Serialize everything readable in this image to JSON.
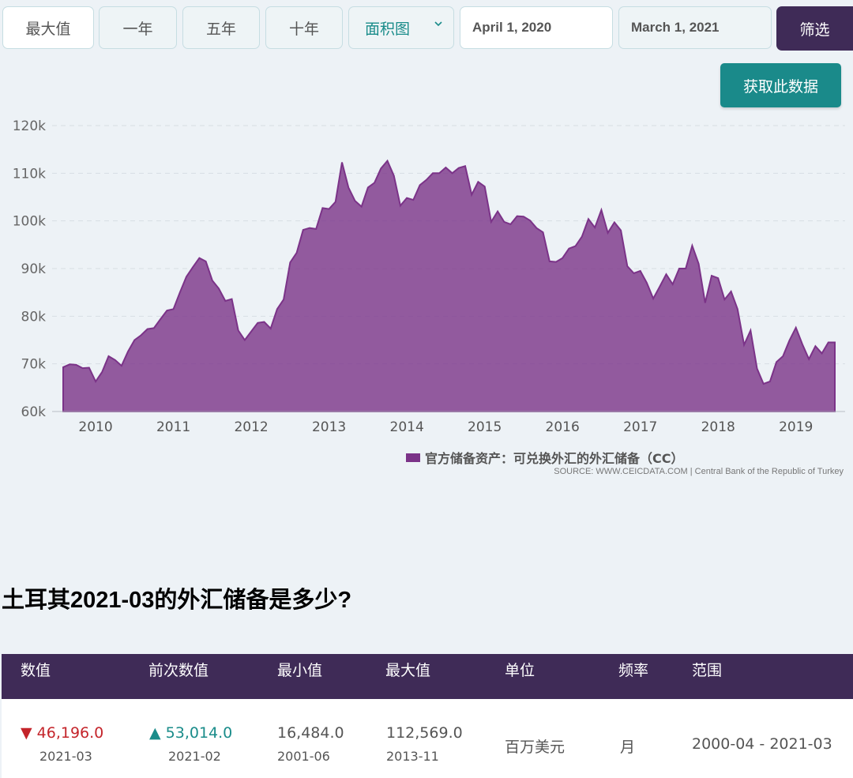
{
  "toolbar": {
    "buttons": [
      "最大值",
      "一年",
      "五年",
      "十年"
    ],
    "chart_type": "面积图",
    "start_date": "April 1, 2020",
    "end_date": "March 1, 2021",
    "filter_label": "筛选",
    "get_data_label": "获取此数据"
  },
  "colors": {
    "area": "#7b3388",
    "accent": "#1a8a8a",
    "header": "#3f2b57"
  },
  "source": "SOURCE: WWW.CEICDATA.COM | Central Bank of the Republic of Turkey",
  "question": "土耳其2021-03的外汇储备是多少?",
  "table": {
    "headers": [
      "数值",
      "前次数值",
      "最小值",
      "最大值",
      "单位",
      "频率",
      "范围"
    ],
    "value": "46,196.0",
    "value_date": "2021-03",
    "prev_value": "53,014.0",
    "prev_date": "2021-02",
    "min_value": "16,484.0",
    "min_date": "2001-06",
    "max_value": "112,569.0",
    "max_date": "2013-11",
    "unit": "百万美元",
    "frequency": "月",
    "range": "2000-04 - 2021-03"
  },
  "chart_data": {
    "type": "area",
    "series": [
      {
        "name": "官方储备资产：可兑换外汇的外汇储备（CC）",
        "x_start": "2009-08",
        "frequency": "monthly",
        "values": [
          69.3,
          69.9,
          69.8,
          69.1,
          69.2,
          66.3,
          68.3,
          71.6,
          70.8,
          69.6,
          72.6,
          75.0,
          76.0,
          77.3,
          77.5,
          79.4,
          81.2,
          81.5,
          85.0,
          88.3,
          90.3,
          92.2,
          91.5,
          87.5,
          85.8,
          83.2,
          83.6,
          77.0,
          75.0,
          76.8,
          78.6,
          78.8,
          77.4,
          81.5,
          83.5,
          91.3,
          93.3,
          98.1,
          98.5,
          98.3,
          102.7,
          102.5,
          104.0,
          112.3,
          107.0,
          104.2,
          103.0,
          107.0,
          108.0,
          111.0,
          112.6,
          109.5,
          103.2,
          104.8,
          104.4,
          107.5,
          108.6,
          110.0,
          110.0,
          111.2,
          110.0,
          111.1,
          111.5,
          105.5,
          108.2,
          107.2,
          99.8,
          102.0,
          99.8,
          99.3,
          101.0,
          100.9,
          100.1,
          98.5,
          97.6,
          91.5,
          91.4,
          92.2,
          94.2,
          94.7,
          96.7,
          100.4,
          98.6,
          102.3,
          97.5,
          99.7,
          98.0,
          90.5,
          89.0,
          89.5,
          87.0,
          83.7,
          86.2,
          88.8,
          86.7,
          90.0,
          90.0,
          94.8,
          91.0,
          82.8,
          88.5,
          88.0,
          83.5,
          85.2,
          81.5,
          74.0,
          77.0,
          69.0,
          65.8,
          66.3,
          70.4,
          71.6,
          74.9,
          77.6,
          74.1,
          71.0,
          73.7,
          72.2,
          74.5,
          74.5
        ]
      }
    ],
    "x_ticks": [
      "2010",
      "2011",
      "2012",
      "2013",
      "2014",
      "2015",
      "2016",
      "2017",
      "2018",
      "2019"
    ],
    "y_ticks": [
      "60k",
      "70k",
      "80k",
      "90k",
      "100k",
      "110k",
      "120k"
    ],
    "ylim": [
      60000,
      120000
    ],
    "y_unit": "thousands",
    "legend_position": "bottom-right",
    "grid": true
  }
}
